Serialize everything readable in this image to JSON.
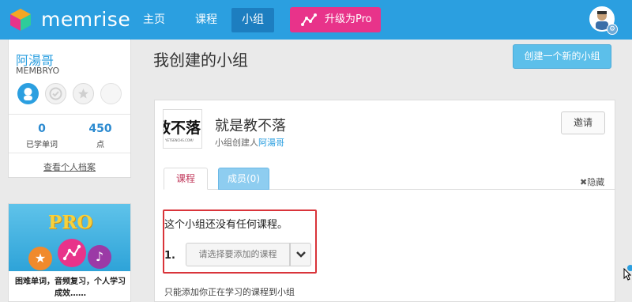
{
  "header": {
    "logo_text": "memrise",
    "nav": {
      "home": "主页",
      "courses": "课程",
      "groups": "小组"
    },
    "upgrade_label": "升级为Pro",
    "accent_color": "#2b9fe0",
    "pro_color": "#e8338a"
  },
  "profile": {
    "display_name": "阿湯哥",
    "username": "MEMBRYO",
    "words_learned": "0",
    "words_label": "已学单词",
    "points": "450",
    "points_label": "点",
    "view_profile": "查看个人档案"
  },
  "promo": {
    "title": "PRO",
    "description": "困难单词，音频复习，个人学习成效……"
  },
  "page": {
    "title": "我创建的小组",
    "create_button": "创建一个新的小组"
  },
  "group": {
    "thumb_text": "教不落",
    "thumb_sub": "YETSENCHS.COM/",
    "name": "就是教不落",
    "creator_prefix": "小组创建人",
    "creator_name": "阿湯哥",
    "invite_label": "邀请",
    "tabs": {
      "courses": "课程",
      "members": "成员(0)"
    },
    "hide_label": "隐藏",
    "no_courses": "这个小组还没有任何课程。",
    "step_number": "1.",
    "select_placeholder": "请选择要添加的课程",
    "only_note": "只能添加你正在学习的课程到小组"
  }
}
